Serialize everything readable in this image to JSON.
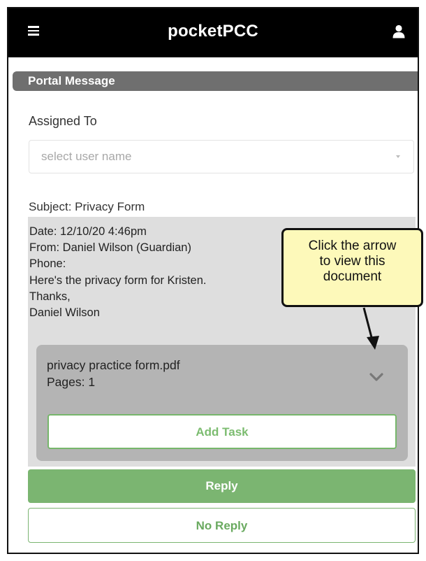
{
  "app": {
    "title": "pocketPCC",
    "menu_icon": "hamburger-menu-icon",
    "user_icon": "user-icon",
    "header_bg": "#000000"
  },
  "section": {
    "header": "Portal Message",
    "header_bg": "#6f6f6f"
  },
  "assigned": {
    "label": "Assigned To",
    "placeholder": "select user name"
  },
  "message": {
    "subject": "Subject: Privacy Form",
    "lines": [
      "Date: 12/10/20 4:46pm",
      "From: Daniel Wilson (Guardian)",
      "Phone:",
      "Here's the privacy form for Kristen.",
      "Thanks,",
      "Daniel Wilson"
    ],
    "panel_bg": "#dedede"
  },
  "attachment": {
    "name": "privacy practice form.pdf",
    "pages": "Pages: 1",
    "expand_icon": "chevron-down-icon",
    "add_task_label": "Add Task"
  },
  "actions": {
    "reply_label": "Reply",
    "no_reply_label": "No Reply",
    "accent": "#7bb571"
  },
  "callout": {
    "lines": [
      "Click the arrow",
      "to view this",
      "document"
    ],
    "bg": "#fdf9ba"
  }
}
